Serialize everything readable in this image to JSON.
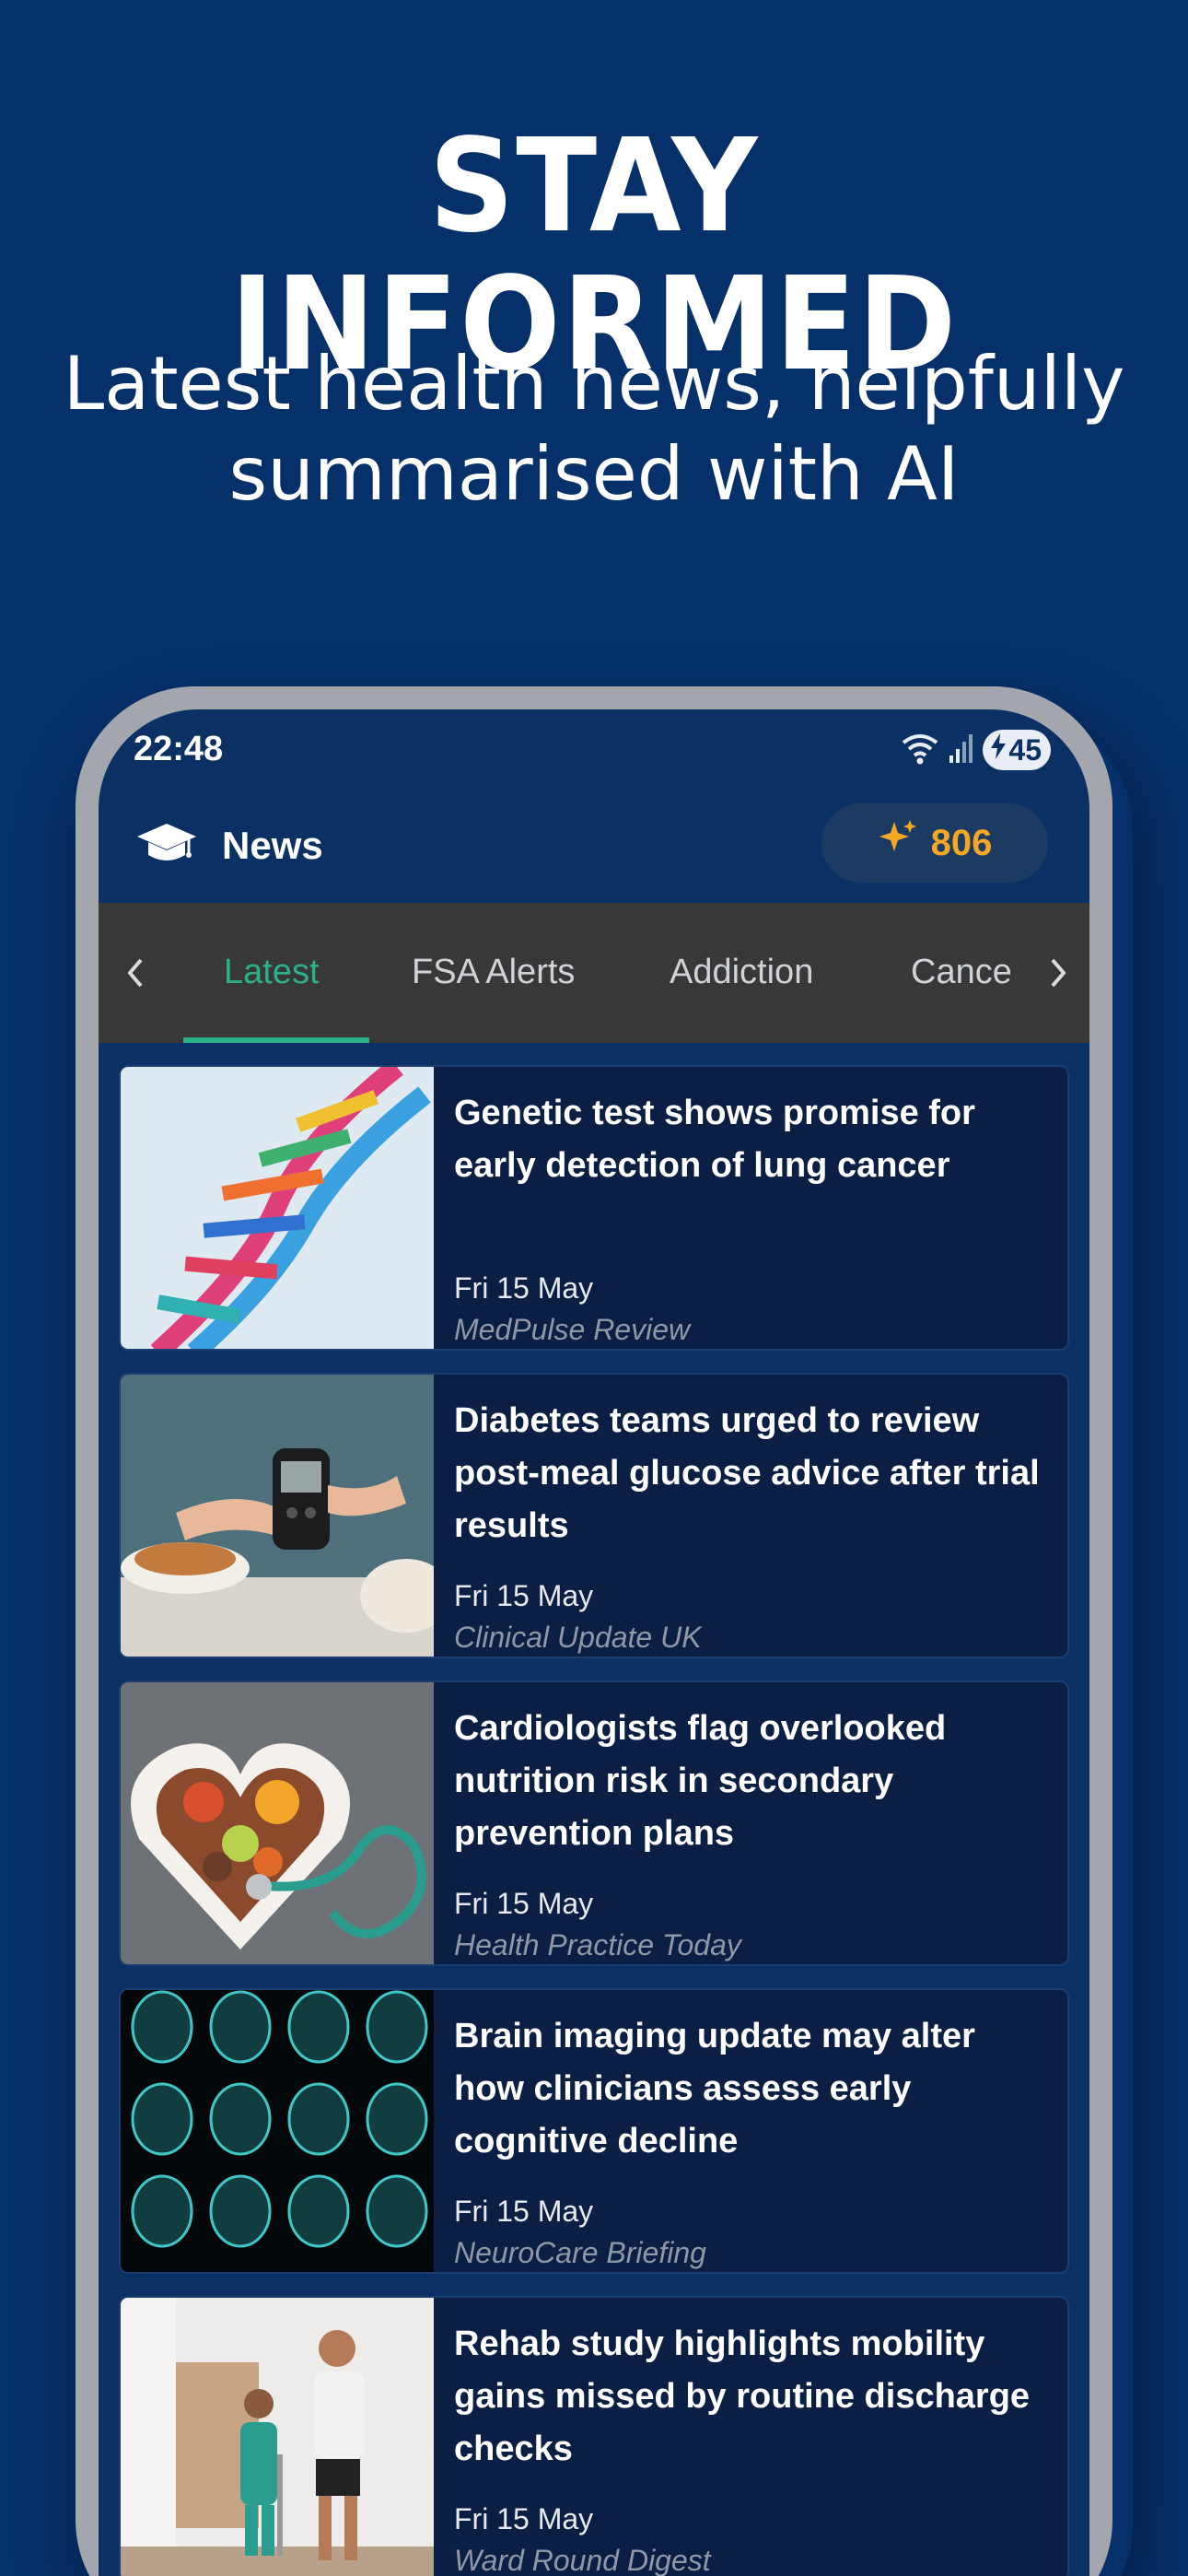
{
  "promo": {
    "title": "STAY INFORMED",
    "subtitle": "Latest health news, helpfully summarised with AI"
  },
  "status_bar": {
    "time": "22:48",
    "battery_level": "45"
  },
  "header": {
    "title": "News",
    "points": "806"
  },
  "tabs": [
    {
      "label": "Latest",
      "active": true
    },
    {
      "label": "FSA Alerts",
      "active": false
    },
    {
      "label": "Addiction",
      "active": false
    },
    {
      "label": "Cance",
      "active": false
    }
  ],
  "articles": [
    {
      "headline": "Genetic test shows promise for early detection of lung cancer",
      "date": "Fri 15 May",
      "source": "MedPulse Review",
      "thumbnail": "dna-helix-image"
    },
    {
      "headline": "Diabetes teams urged to review post-meal glucose advice after trial results",
      "date": "Fri 15 May",
      "source": "Clinical Update UK",
      "thumbnail": "glucose-meter-image"
    },
    {
      "headline": "Cardiologists flag overlooked nutrition risk in secondary prevention plans",
      "date": "Fri 15 May",
      "source": "Health Practice Today",
      "thumbnail": "heart-bowl-stethoscope-image"
    },
    {
      "headline": "Brain imaging update may alter how clinicians assess early cognitive decline",
      "date": "Fri 15 May",
      "source": "NeuroCare Briefing",
      "thumbnail": "brain-scans-image"
    },
    {
      "headline": "Rehab study highlights mobility gains missed by routine discharge checks",
      "date": "Fri 15 May",
      "source": "Ward Round Digest",
      "thumbnail": "physiotherapy-image"
    }
  ],
  "colors": {
    "background": "#06306a",
    "accent_green": "#2bb08a",
    "points_orange": "#f5a623",
    "tab_bar": "#383838",
    "card": "#0b1f45"
  }
}
